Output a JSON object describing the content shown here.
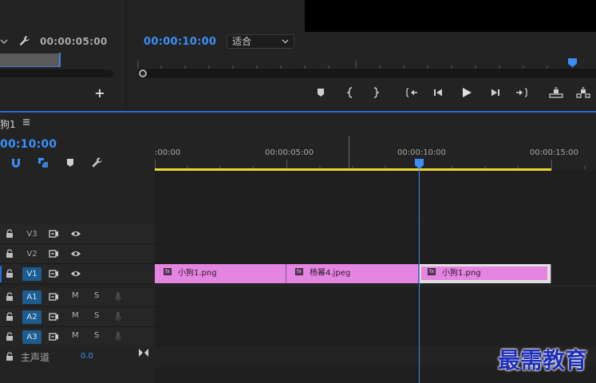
{
  "source_monitor": {
    "timecode": "00:00:05:00",
    "add_label": "+",
    "wrench_icon": "wrench-icon",
    "progress": 0.52
  },
  "program_monitor": {
    "timecode": "00:00:10:00",
    "fit_select": {
      "value": "适合"
    },
    "transport": [
      "marker-icon",
      "mark-in-icon",
      "mark-out-icon",
      "go-to-in-icon",
      "step-back-icon",
      "play-icon",
      "step-forward-icon",
      "go-to-out-icon",
      "lift-icon",
      "extract-icon"
    ],
    "accent_color": "#3a8ff5"
  },
  "timeline": {
    "sequence_title": "狗1",
    "menu_glyph": "≡",
    "timecode": "00:10:00",
    "tools": [
      "snap-icon",
      "linked-selection-icon",
      "add-marker-icon",
      "timeline-settings-icon"
    ],
    "ruler_labels": [
      ":00:00",
      "00:00:05:00",
      "00:00:10:00",
      "00:00:15:00"
    ],
    "video_tracks": [
      {
        "name": "V3",
        "active": false
      },
      {
        "name": "V2",
        "active": false
      },
      {
        "name": "V1",
        "active": true
      }
    ],
    "audio_tracks": [
      {
        "name": "A1",
        "mute": "M",
        "solo": "S"
      },
      {
        "name": "A2",
        "mute": "M",
        "solo": "S"
      },
      {
        "name": "A3",
        "mute": "M",
        "solo": "S"
      }
    ],
    "clips": [
      {
        "name": "小狗1.png",
        "fx": "fx",
        "selected": false
      },
      {
        "name": "杨幂4.jpeg",
        "fx": "fx",
        "selected": false
      },
      {
        "name": "小狗1.png",
        "fx": "fx",
        "selected": true
      }
    ],
    "clip_color": "#e585e2",
    "work_area_color": "#e8d934",
    "master": {
      "label": "主声道",
      "value": "0.0"
    }
  },
  "watermark": "最需教育"
}
